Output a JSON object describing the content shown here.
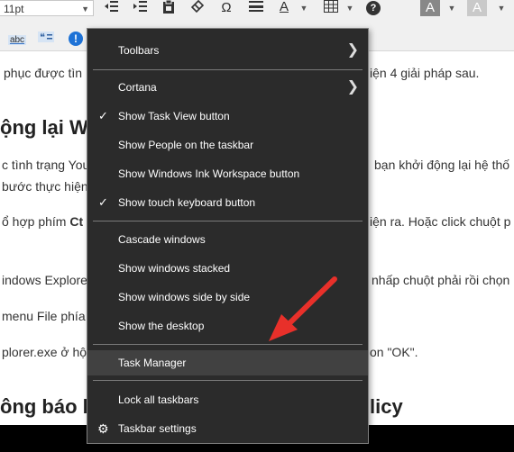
{
  "toolbar": {
    "font_size_value": "11pt",
    "icons": [
      "indent-decrease-icon",
      "indent-increase-icon",
      "paste-icon",
      "eraser-icon",
      "omega-icon",
      "horizontal-rule-icon",
      "font-color-icon",
      "table-icon",
      "help-icon",
      "highlight-color-icon",
      "shade-icon"
    ],
    "omega_glyph": "Ω",
    "font_color_glyph": "A",
    "help_glyph": "?",
    "highlight_glyph": "A",
    "shade_glyph": "A",
    "spell_label": "abc",
    "info_glyph": "!"
  },
  "article": {
    "line1": "phục được tìn",
    "line1_right": "iện 4 giải pháp sau.",
    "heading1": "ộng lại W",
    "line2_left": "c tình trạng You",
    "line2_right": "bạn khởi động lại hệ thố",
    "line3": "bước thực hiện",
    "line4_left_plain": "ổ hợp phím ",
    "line4_left_bold": "Ct",
    "line4_right": "iện ra. Hoặc click chuột p",
    "line5_left": "indows Explore",
    "line5_right": "nhấp chuột phải rồi chọn",
    "line6": "menu File phía",
    "line7_left": "plorer.exe ở hộ",
    "line7_right": "on \"OK\".",
    "heading2_left": "ông báo b",
    "heading2_right": "licy"
  },
  "context_menu": {
    "items": [
      {
        "label": "Toolbars",
        "checked": false,
        "submenu": true
      },
      {
        "label": "Cortana",
        "checked": false,
        "submenu": true
      },
      {
        "label": "Show Task View button",
        "checked": true,
        "submenu": false
      },
      {
        "label": "Show People on the taskbar",
        "checked": false,
        "submenu": false
      },
      {
        "label": "Show Windows Ink Workspace button",
        "checked": false,
        "submenu": false
      },
      {
        "label": "Show touch keyboard button",
        "checked": true,
        "submenu": false
      },
      {
        "label": "Cascade windows",
        "checked": false,
        "submenu": false
      },
      {
        "label": "Show windows stacked",
        "checked": false,
        "submenu": false
      },
      {
        "label": "Show windows side by side",
        "checked": false,
        "submenu": false
      },
      {
        "label": "Show the desktop",
        "checked": false,
        "submenu": false
      },
      {
        "label": "Task Manager",
        "checked": false,
        "submenu": false,
        "highlighted": true
      },
      {
        "label": "Lock all taskbars",
        "checked": false,
        "submenu": false
      },
      {
        "label": "Taskbar settings",
        "checked": false,
        "submenu": false,
        "icon": "gear-icon"
      }
    ],
    "check_glyph": "✓",
    "arrow_glyph": "❯",
    "gear_glyph": "⚙"
  },
  "colors": {
    "menu_bg": "#2b2b2b",
    "menu_hover": "#414141",
    "annotation_arrow": "#e8302a",
    "info_blue": "#1e72d6"
  }
}
